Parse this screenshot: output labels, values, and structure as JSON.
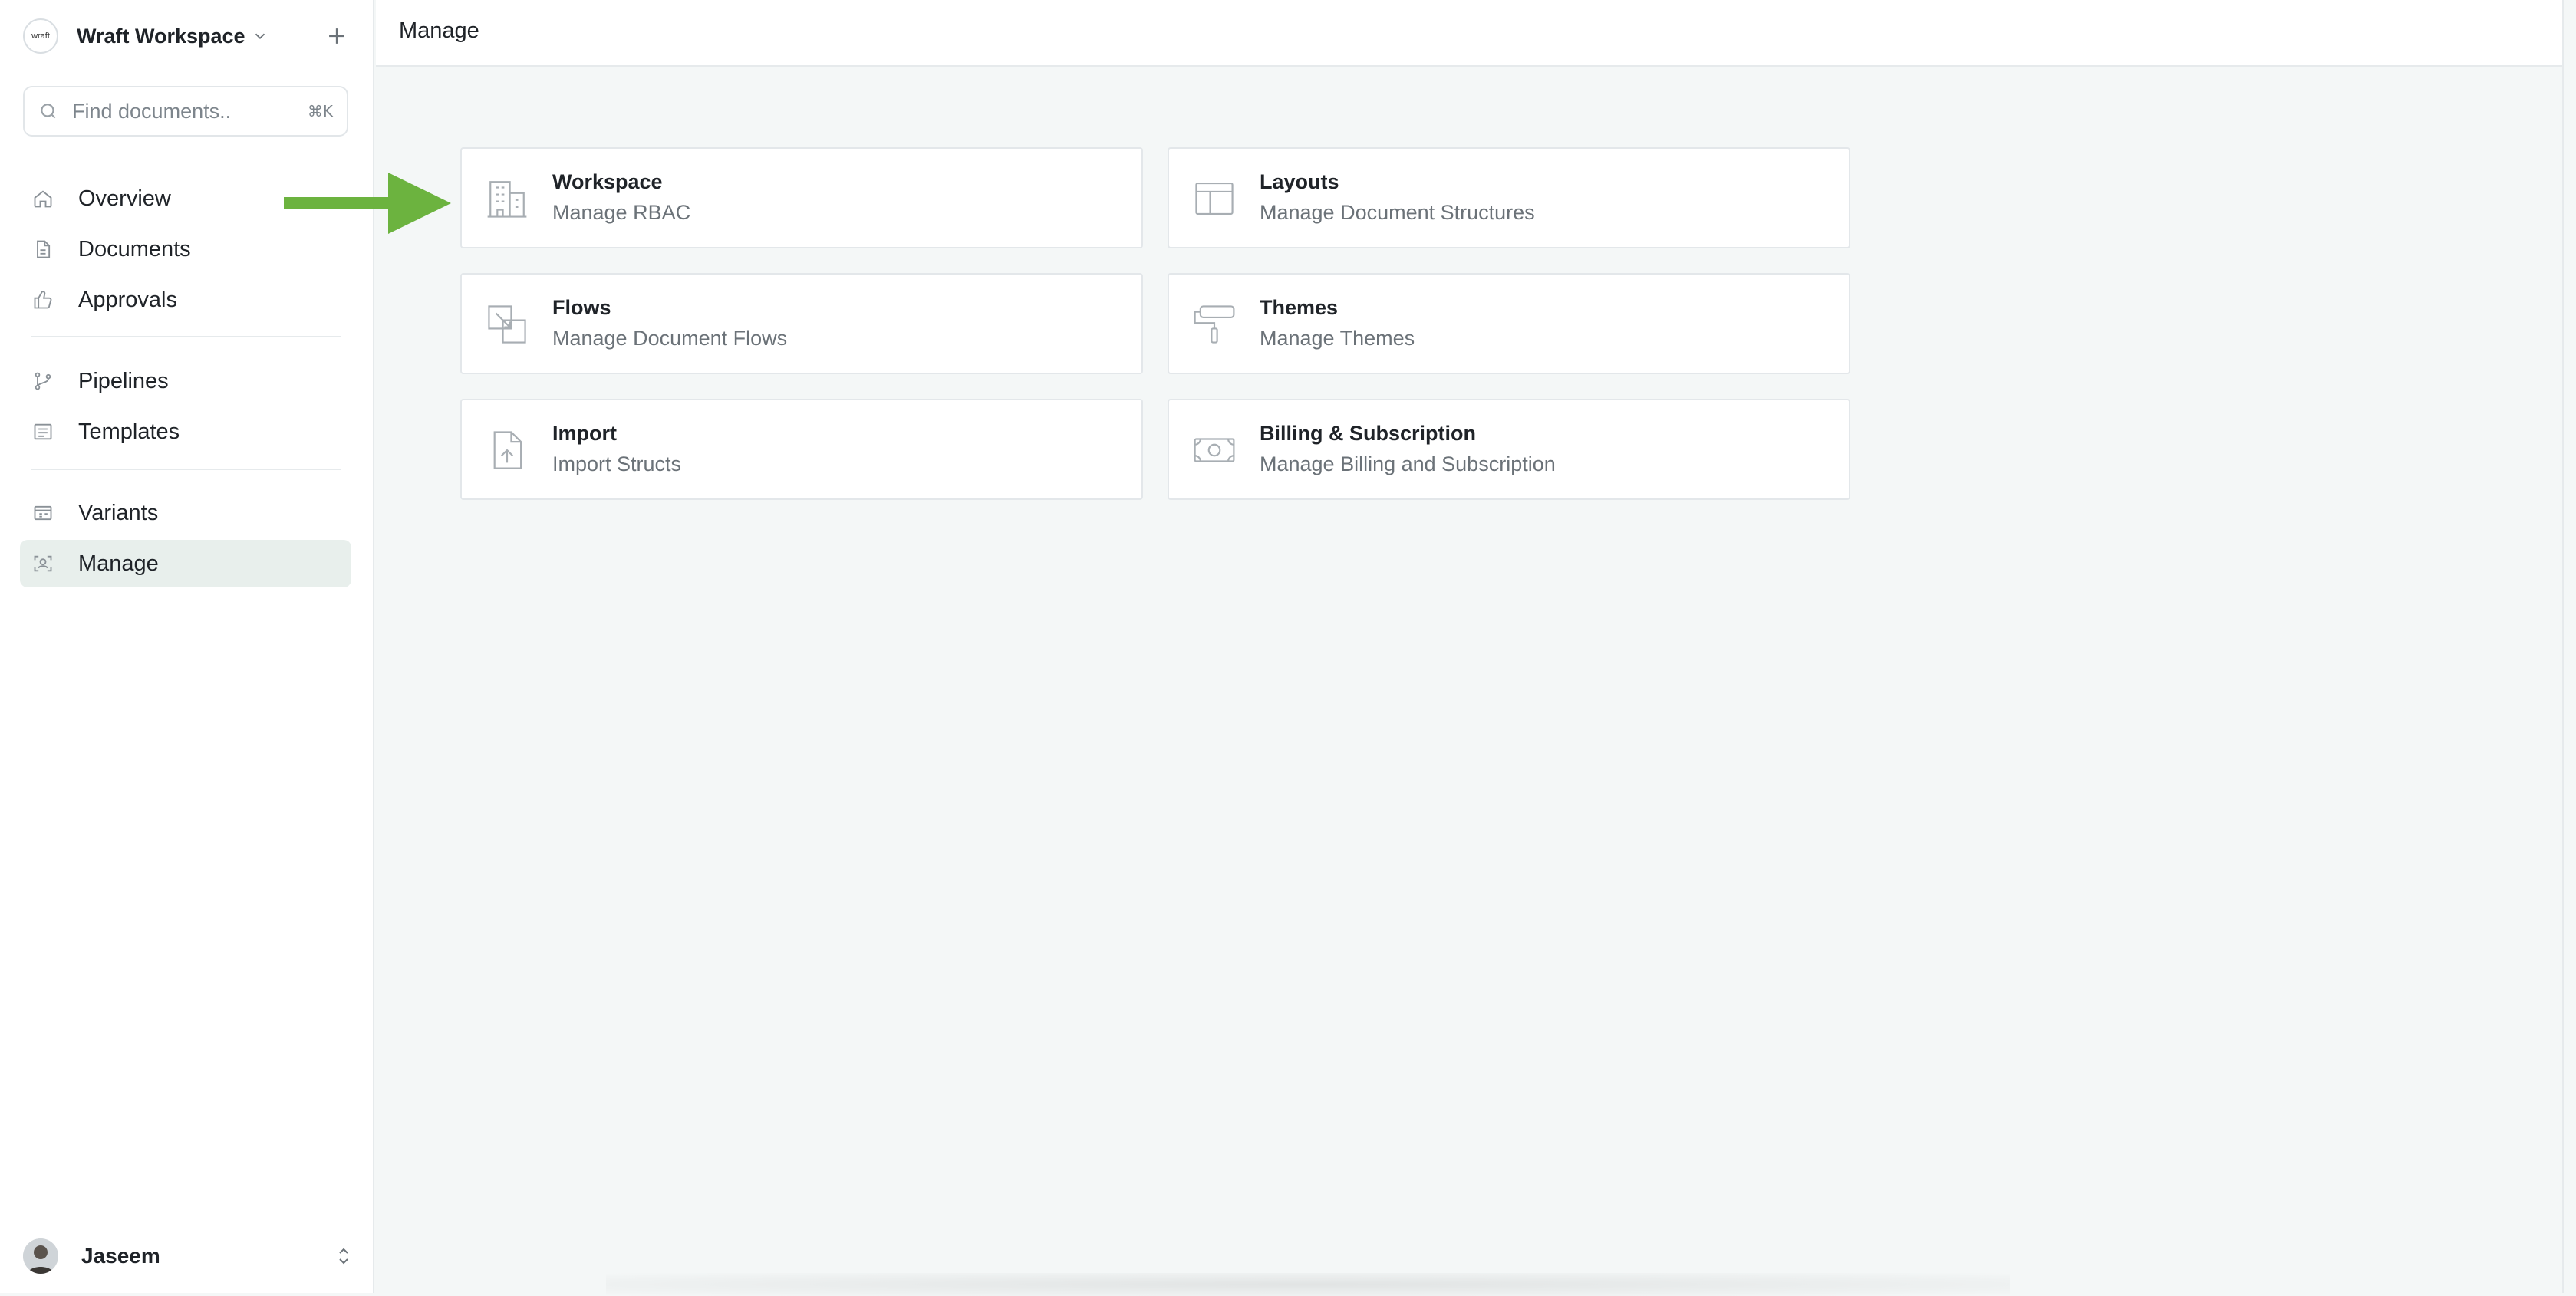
{
  "workspace": {
    "name": "Wraft Workspace",
    "logo_text": "wraft"
  },
  "search": {
    "placeholder": "Find documents..",
    "shortcut": "⌘K"
  },
  "nav_primary": [
    {
      "label": "Overview",
      "icon": "home-icon"
    },
    {
      "label": "Documents",
      "icon": "document-icon"
    },
    {
      "label": "Approvals",
      "icon": "thumbs-up-icon"
    }
  ],
  "nav_secondary": [
    {
      "label": "Pipelines",
      "icon": "git-branch-icon"
    },
    {
      "label": "Templates",
      "icon": "list-icon"
    }
  ],
  "nav_tertiary": [
    {
      "label": "Variants",
      "icon": "variants-icon"
    },
    {
      "label": "Manage",
      "icon": "user-focus-icon",
      "active": true
    }
  ],
  "user": {
    "name": "Jaseem"
  },
  "header": {
    "title": "Manage"
  },
  "cards": [
    {
      "title": "Workspace",
      "subtitle": "Manage RBAC",
      "icon": "building-icon"
    },
    {
      "title": "Layouts",
      "subtitle": "Manage Document Structures",
      "icon": "layout-icon"
    },
    {
      "title": "Flows",
      "subtitle": "Manage Document Flows",
      "icon": "flows-icon"
    },
    {
      "title": "Themes",
      "subtitle": "Manage Themes",
      "icon": "paint-roller-icon"
    },
    {
      "title": "Import",
      "subtitle": "Import Structs",
      "icon": "file-upload-icon"
    },
    {
      "title": "Billing & Subscription",
      "subtitle": "Manage Billing and Subscription",
      "icon": "money-icon"
    }
  ],
  "colors": {
    "accent_arrow": "#6cb33f",
    "active_bg": "#e8efec",
    "muted_text": "#6b7278",
    "icon_stroke": "#a8aeb3"
  }
}
